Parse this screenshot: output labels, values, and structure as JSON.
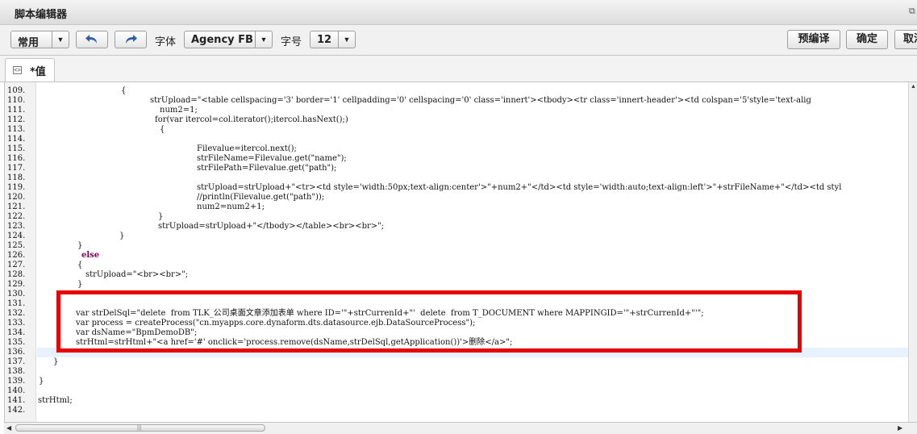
{
  "window": {
    "title": "脚本编辑器"
  },
  "toolbar": {
    "style_value": "常用",
    "font_label": "字体",
    "font_value": "Agency FB",
    "size_label": "字号",
    "size_value": "12",
    "precompile_label": "预编译",
    "ok_label": "确定",
    "cancel_label": "取消"
  },
  "tab": {
    "label": "*值"
  },
  "editor": {
    "line_numbers": [
      "109.",
      "110.",
      "111.",
      "112.",
      "113.",
      "114.",
      "115.",
      "116.",
      "117.",
      "118.",
      "119.",
      "120.",
      "121.",
      "122.",
      "123.",
      "124.",
      "125.",
      "126.",
      "127.",
      "128.",
      "129.",
      "130.",
      "131.",
      "132.",
      "133.",
      "134.",
      "135.",
      "136.",
      "137.",
      "138.",
      "139.",
      "140.",
      "141.",
      "142."
    ],
    "current_line": "136.",
    "lines": [
      "{",
      "strUpload=\"<table cellspacing='3' border='1' cellpadding='0' cellspacing='0' class='innert'><tbody><tr class='innert-header'><td colspan='5'style='text-alig",
      "num2=1;",
      "for(var itercol=col.iterator();itercol.hasNext();)",
      "{",
      "",
      "Filevalue=itercol.next();",
      "strFileName=Filevalue.get(\"name\");",
      "strFilePath=Filevalue.get(\"path\");",
      "",
      "strUpload=strUpload+\"<tr><td style='width:50px;text-align:center'>\"+num2+\"</td><td style='width:auto;text-align:left'>\"+strFileName+\"</td><td styl",
      "//println(Filevalue.get(\"path\"));",
      "num2=num2+1;",
      "}",
      "strUpload=strUpload+\"</tbody></table><br><br>\";",
      "}",
      "}",
      "else",
      "{",
      "strUpload=\"<br><br>\";",
      "}",
      "",
      "",
      "var strDelSql=\"delete  from TLK_公司桌面文章添加表单 where ID='\"+strCurrenId+\"'  delete  from T_DOCUMENT where MAPPINGID='\"+strCurrenId+\"'\";",
      "var process = createProcess(\"cn.myapps.core.dynaform.dts.datasource.ejb.DataSourceProcess\");",
      "var dsName=\"BpmDemoDB\";",
      "strHtml=strHtml+\"<a href='#' onclick='process.remove(dsName,strDelSql,getApplication())'>删除</a>\";",
      "",
      "}",
      "",
      "}",
      "",
      "strHtml;",
      ""
    ]
  }
}
